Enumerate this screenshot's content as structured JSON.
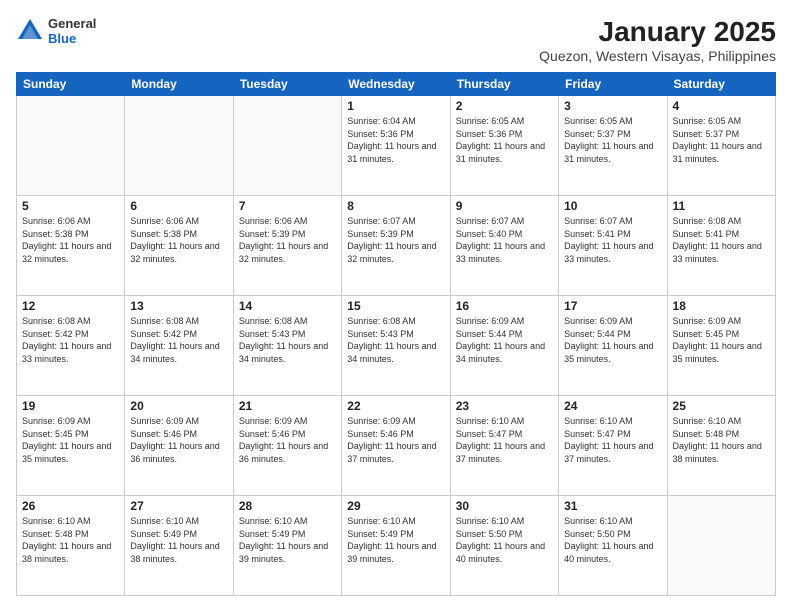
{
  "header": {
    "logo": {
      "general": "General",
      "blue": "Blue"
    },
    "title": "January 2025",
    "location": "Quezon, Western Visayas, Philippines"
  },
  "weekdays": [
    "Sunday",
    "Monday",
    "Tuesday",
    "Wednesday",
    "Thursday",
    "Friday",
    "Saturday"
  ],
  "weeks": [
    [
      {
        "day": "",
        "info": ""
      },
      {
        "day": "",
        "info": ""
      },
      {
        "day": "",
        "info": ""
      },
      {
        "day": "1",
        "info": "Sunrise: 6:04 AM\nSunset: 5:36 PM\nDaylight: 11 hours\nand 31 minutes."
      },
      {
        "day": "2",
        "info": "Sunrise: 6:05 AM\nSunset: 5:36 PM\nDaylight: 11 hours\nand 31 minutes."
      },
      {
        "day": "3",
        "info": "Sunrise: 6:05 AM\nSunset: 5:37 PM\nDaylight: 11 hours\nand 31 minutes."
      },
      {
        "day": "4",
        "info": "Sunrise: 6:05 AM\nSunset: 5:37 PM\nDaylight: 11 hours\nand 31 minutes."
      }
    ],
    [
      {
        "day": "5",
        "info": "Sunrise: 6:06 AM\nSunset: 5:38 PM\nDaylight: 11 hours\nand 32 minutes."
      },
      {
        "day": "6",
        "info": "Sunrise: 6:06 AM\nSunset: 5:38 PM\nDaylight: 11 hours\nand 32 minutes."
      },
      {
        "day": "7",
        "info": "Sunrise: 6:06 AM\nSunset: 5:39 PM\nDaylight: 11 hours\nand 32 minutes."
      },
      {
        "day": "8",
        "info": "Sunrise: 6:07 AM\nSunset: 5:39 PM\nDaylight: 11 hours\nand 32 minutes."
      },
      {
        "day": "9",
        "info": "Sunrise: 6:07 AM\nSunset: 5:40 PM\nDaylight: 11 hours\nand 33 minutes."
      },
      {
        "day": "10",
        "info": "Sunrise: 6:07 AM\nSunset: 5:41 PM\nDaylight: 11 hours\nand 33 minutes."
      },
      {
        "day": "11",
        "info": "Sunrise: 6:08 AM\nSunset: 5:41 PM\nDaylight: 11 hours\nand 33 minutes."
      }
    ],
    [
      {
        "day": "12",
        "info": "Sunrise: 6:08 AM\nSunset: 5:42 PM\nDaylight: 11 hours\nand 33 minutes."
      },
      {
        "day": "13",
        "info": "Sunrise: 6:08 AM\nSunset: 5:42 PM\nDaylight: 11 hours\nand 34 minutes."
      },
      {
        "day": "14",
        "info": "Sunrise: 6:08 AM\nSunset: 5:43 PM\nDaylight: 11 hours\nand 34 minutes."
      },
      {
        "day": "15",
        "info": "Sunrise: 6:08 AM\nSunset: 5:43 PM\nDaylight: 11 hours\nand 34 minutes."
      },
      {
        "day": "16",
        "info": "Sunrise: 6:09 AM\nSunset: 5:44 PM\nDaylight: 11 hours\nand 34 minutes."
      },
      {
        "day": "17",
        "info": "Sunrise: 6:09 AM\nSunset: 5:44 PM\nDaylight: 11 hours\nand 35 minutes."
      },
      {
        "day": "18",
        "info": "Sunrise: 6:09 AM\nSunset: 5:45 PM\nDaylight: 11 hours\nand 35 minutes."
      }
    ],
    [
      {
        "day": "19",
        "info": "Sunrise: 6:09 AM\nSunset: 5:45 PM\nDaylight: 11 hours\nand 35 minutes."
      },
      {
        "day": "20",
        "info": "Sunrise: 6:09 AM\nSunset: 5:46 PM\nDaylight: 11 hours\nand 36 minutes."
      },
      {
        "day": "21",
        "info": "Sunrise: 6:09 AM\nSunset: 5:46 PM\nDaylight: 11 hours\nand 36 minutes."
      },
      {
        "day": "22",
        "info": "Sunrise: 6:09 AM\nSunset: 5:46 PM\nDaylight: 11 hours\nand 37 minutes."
      },
      {
        "day": "23",
        "info": "Sunrise: 6:10 AM\nSunset: 5:47 PM\nDaylight: 11 hours\nand 37 minutes."
      },
      {
        "day": "24",
        "info": "Sunrise: 6:10 AM\nSunset: 5:47 PM\nDaylight: 11 hours\nand 37 minutes."
      },
      {
        "day": "25",
        "info": "Sunrise: 6:10 AM\nSunset: 5:48 PM\nDaylight: 11 hours\nand 38 minutes."
      }
    ],
    [
      {
        "day": "26",
        "info": "Sunrise: 6:10 AM\nSunset: 5:48 PM\nDaylight: 11 hours\nand 38 minutes."
      },
      {
        "day": "27",
        "info": "Sunrise: 6:10 AM\nSunset: 5:49 PM\nDaylight: 11 hours\nand 38 minutes."
      },
      {
        "day": "28",
        "info": "Sunrise: 6:10 AM\nSunset: 5:49 PM\nDaylight: 11 hours\nand 39 minutes."
      },
      {
        "day": "29",
        "info": "Sunrise: 6:10 AM\nSunset: 5:49 PM\nDaylight: 11 hours\nand 39 minutes."
      },
      {
        "day": "30",
        "info": "Sunrise: 6:10 AM\nSunset: 5:50 PM\nDaylight: 11 hours\nand 40 minutes."
      },
      {
        "day": "31",
        "info": "Sunrise: 6:10 AM\nSunset: 5:50 PM\nDaylight: 11 hours\nand 40 minutes."
      },
      {
        "day": "",
        "info": ""
      }
    ]
  ]
}
